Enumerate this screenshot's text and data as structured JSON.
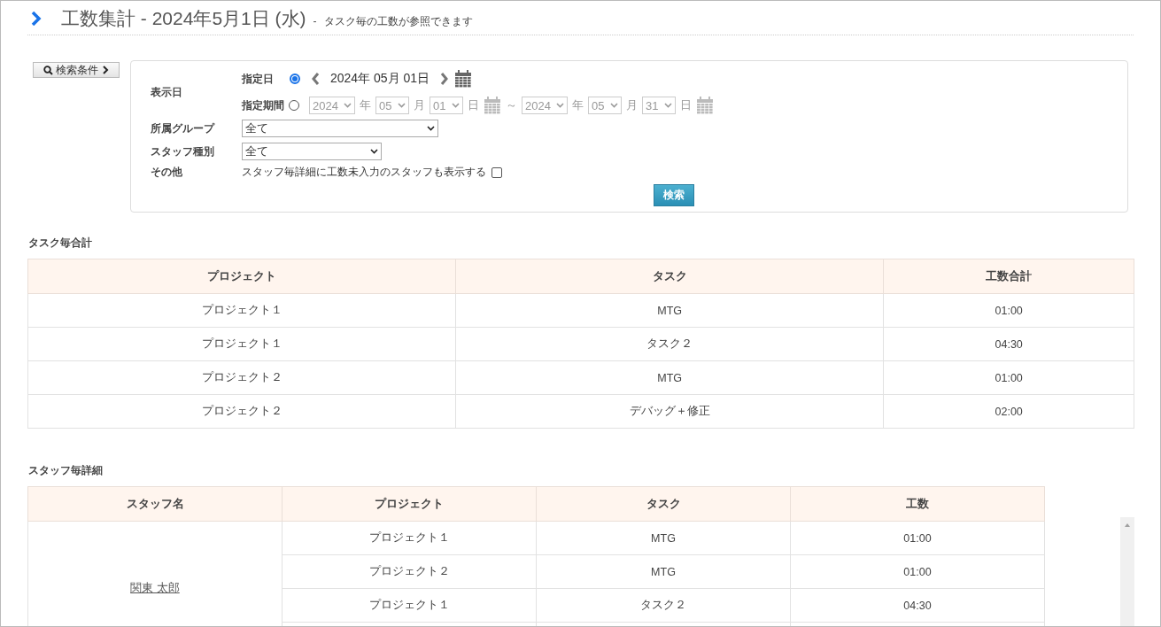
{
  "header": {
    "title": "工数集計 - 2024年5月1日 (水)",
    "separator": "-",
    "subtitle": "タスク毎の工数が参照できます"
  },
  "search_toggle": {
    "label": "検索条件"
  },
  "search_form": {
    "display_date": {
      "label": "表示日",
      "modes": [
        {
          "kind": "single",
          "label": "指定日",
          "selected": true,
          "date": "2024年 05月 01日"
        },
        {
          "kind": "range",
          "label": "指定期間",
          "selected": false,
          "from": {
            "year": "2024",
            "year_unit": "年",
            "month": "05",
            "month_unit": "月",
            "day": "01",
            "day_unit": "日"
          },
          "separator": "～",
          "to": {
            "year": "2024",
            "year_unit": "年",
            "month": "05",
            "month_unit": "月",
            "day": "31",
            "day_unit": "日"
          }
        }
      ]
    },
    "group": {
      "label": "所属グループ",
      "value": "全て"
    },
    "staff_type": {
      "label": "スタッフ種別",
      "value": "全て"
    },
    "other": {
      "label": "その他",
      "option_label": "スタッフ毎詳細に工数未入力のスタッフも表示する",
      "checked": false
    },
    "search_button": "検索"
  },
  "task_totals": {
    "title": "タスク毎合計",
    "columns": [
      "プロジェクト",
      "タスク",
      "工数合計"
    ],
    "rows": [
      [
        "プロジェクト１",
        "MTG",
        "01:00"
      ],
      [
        "プロジェクト１",
        "タスク２",
        "04:30"
      ],
      [
        "プロジェクト２",
        "MTG",
        "01:00"
      ],
      [
        "プロジェクト２",
        "デバッグ＋修正",
        "02:00"
      ]
    ]
  },
  "staff_details": {
    "title": "スタッフ毎詳細",
    "columns": [
      "スタッフ名",
      "プロジェクト",
      "タスク",
      "工数"
    ],
    "staff": [
      {
        "name": "関東 太郎",
        "rows": [
          [
            "プロジェクト１",
            "MTG",
            "01:00"
          ],
          [
            "プロジェクト２",
            "MTG",
            "01:00"
          ],
          [
            "プロジェクト１",
            "タスク２",
            "04:30"
          ]
        ]
      }
    ]
  }
}
